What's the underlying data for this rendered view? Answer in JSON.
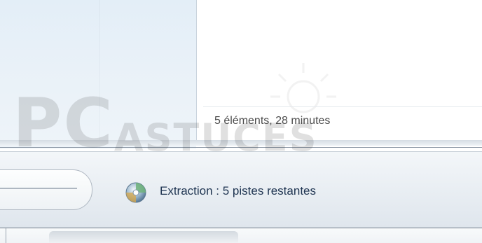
{
  "content": {
    "summary": "5 éléments, 28 minutes"
  },
  "status_bar": {
    "status_text": "Extraction : 5 pistes restantes",
    "status_icon": "rip-progress-disc-icon"
  },
  "watermark": {
    "big": "PC",
    "small": "ASTUCES"
  }
}
